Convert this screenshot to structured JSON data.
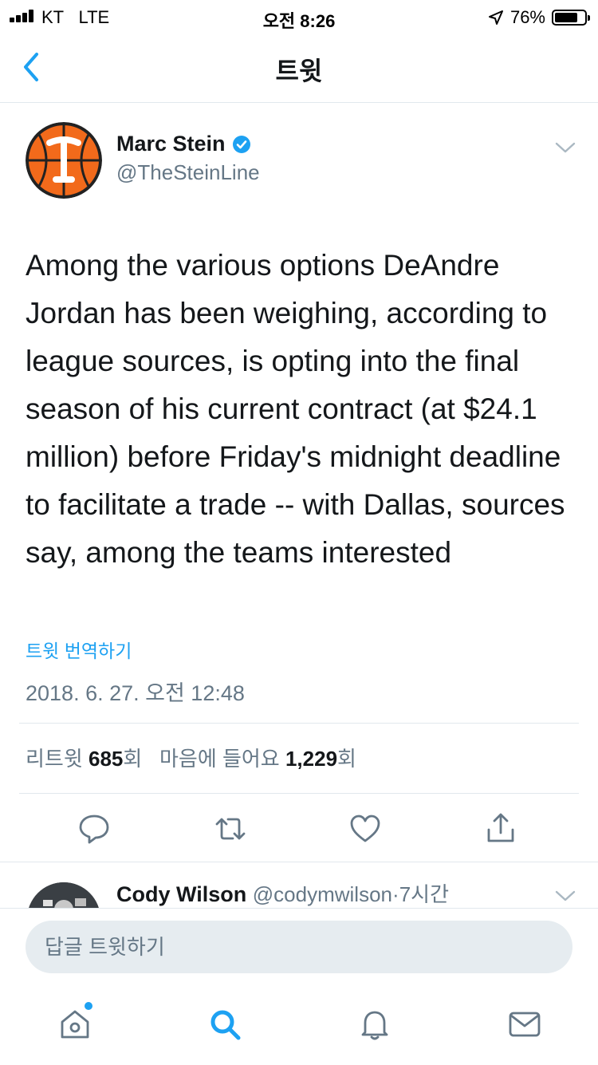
{
  "status_bar": {
    "carrier": "KT",
    "network": "LTE",
    "time": "오전 8:26",
    "battery": "76%"
  },
  "nav": {
    "title": "트윗"
  },
  "tweet": {
    "author_name": "Marc Stein",
    "author_handle": "@TheSteinLine",
    "verified": true,
    "text": "Among the various options DeAndre Jordan has been weighing,  according to league sources, is opting into the final season of his current contract (at $24.1 million) before Friday's midnight deadline to facilitate a trade -- with Dallas, sources say, among the teams interested",
    "translate_label": "트윗 번역하기",
    "timestamp": "2018. 6. 27. 오전 12:48",
    "retweets_label": "리트윗",
    "retweets_count": "685",
    "retweets_suffix": "회",
    "likes_label": "마음에 들어요",
    "likes_count": "1,229",
    "likes_suffix": "회"
  },
  "reply_preview": {
    "author_name": "Cody Wilson",
    "author_handle": "@codymwilson",
    "separator": "·",
    "time_ago": "7시간"
  },
  "reply_bar": {
    "placeholder": "답글 트윗하기"
  },
  "icons": {
    "brand_color": "#1da1f2",
    "secondary_color": "#657786",
    "actions": [
      "reply-icon",
      "retweet-icon",
      "like-icon",
      "share-icon"
    ],
    "tabs": [
      "home-icon",
      "search-icon",
      "notifications-icon",
      "messages-icon"
    ]
  }
}
